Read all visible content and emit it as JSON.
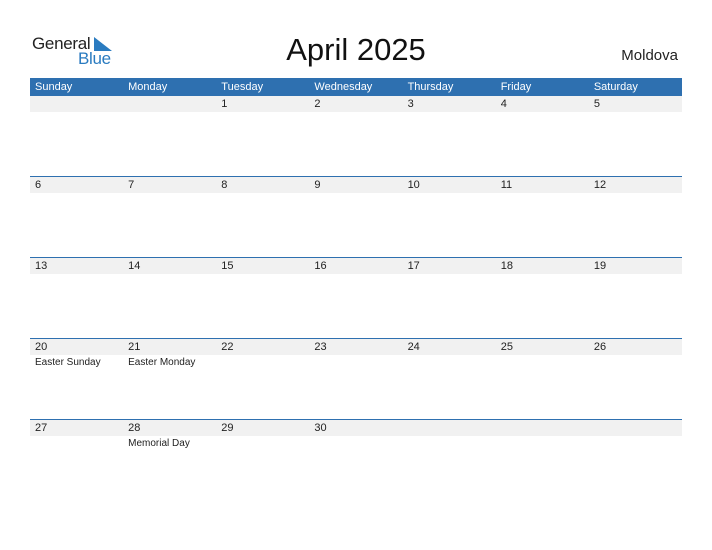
{
  "logo": {
    "word1": "General",
    "word2": "Blue"
  },
  "title": "April 2025",
  "country": "Moldova",
  "weekdays": [
    "Sunday",
    "Monday",
    "Tuesday",
    "Wednesday",
    "Thursday",
    "Friday",
    "Saturday"
  ],
  "weeks": [
    [
      {
        "day": "",
        "event": ""
      },
      {
        "day": "",
        "event": ""
      },
      {
        "day": "1",
        "event": ""
      },
      {
        "day": "2",
        "event": ""
      },
      {
        "day": "3",
        "event": ""
      },
      {
        "day": "4",
        "event": ""
      },
      {
        "day": "5",
        "event": ""
      }
    ],
    [
      {
        "day": "6",
        "event": ""
      },
      {
        "day": "7",
        "event": ""
      },
      {
        "day": "8",
        "event": ""
      },
      {
        "day": "9",
        "event": ""
      },
      {
        "day": "10",
        "event": ""
      },
      {
        "day": "11",
        "event": ""
      },
      {
        "day": "12",
        "event": ""
      }
    ],
    [
      {
        "day": "13",
        "event": ""
      },
      {
        "day": "14",
        "event": ""
      },
      {
        "day": "15",
        "event": ""
      },
      {
        "day": "16",
        "event": ""
      },
      {
        "day": "17",
        "event": ""
      },
      {
        "day": "18",
        "event": ""
      },
      {
        "day": "19",
        "event": ""
      }
    ],
    [
      {
        "day": "20",
        "event": "Easter Sunday"
      },
      {
        "day": "21",
        "event": "Easter Monday"
      },
      {
        "day": "22",
        "event": ""
      },
      {
        "day": "23",
        "event": ""
      },
      {
        "day": "24",
        "event": ""
      },
      {
        "day": "25",
        "event": ""
      },
      {
        "day": "26",
        "event": ""
      }
    ],
    [
      {
        "day": "27",
        "event": ""
      },
      {
        "day": "28",
        "event": "Memorial Day"
      },
      {
        "day": "29",
        "event": ""
      },
      {
        "day": "30",
        "event": ""
      },
      {
        "day": "",
        "event": ""
      },
      {
        "day": "",
        "event": ""
      },
      {
        "day": "",
        "event": ""
      }
    ]
  ],
  "colors": {
    "accent": "#2e70b0",
    "brand_blue": "#2a7bc0",
    "day_strip": "#f1f1f1"
  }
}
